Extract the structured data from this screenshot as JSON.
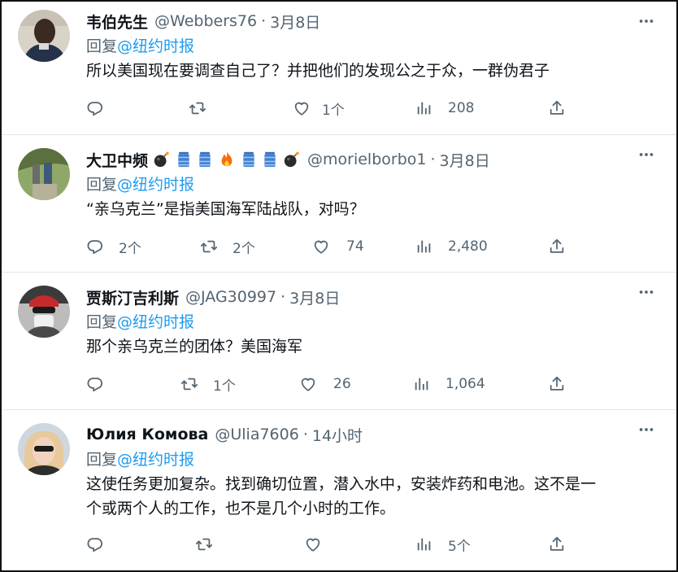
{
  "tweets": [
    {
      "name": "韦伯先生",
      "handle": "@Webbers76",
      "time": "3月8日",
      "reply_prefix": "回复",
      "mention": "@纽约时报",
      "text": "所以美国现在要调查自己了？并把他们的发现公之于众，一群伪君子",
      "replies": "",
      "retweets": "",
      "likes": "1个",
      "views": "208"
    },
    {
      "name": "大卫中频",
      "name_emojis": [
        "bomb-icon",
        "water-bottle-icon",
        "water-bottle-icon",
        "fire-icon",
        "water-bottle-icon",
        "water-bottle-icon",
        "bomb-icon"
      ],
      "handle": "@morielborbo1",
      "time": "3月8日",
      "reply_prefix": "回复",
      "mention": "@纽约时报",
      "text": "“亲乌克兰”是指美国海军陆战队，对吗？",
      "replies": "2个",
      "retweets": "2个",
      "likes": "74",
      "views": "2,480"
    },
    {
      "name": "贾斯汀吉利斯",
      "handle": "@JAG30997",
      "time": "3月8日",
      "reply_prefix": "回复",
      "mention": "@纽约时报",
      "text": "那个亲乌克兰的团体？美国海军",
      "replies": "",
      "retweets": "1个",
      "likes": "26",
      "views": "1,064"
    },
    {
      "name": "Юлия Комова",
      "handle": "@Ulia7606",
      "time": "14小时",
      "reply_prefix": "回复",
      "mention": "@纽约时报",
      "text_line1": "这使任务更加复杂。找到确切位置，潜入水中，安装炸药和电池。这不是一",
      "text_line2": "个或两个人的工作，也不是几个小时的工作。",
      "replies": "",
      "retweets": "",
      "likes": "",
      "views": "5个"
    }
  ],
  "colors": {
    "text": "#0f1419",
    "muted": "#536471",
    "link": "#1d9bf0",
    "divider": "#e3e6e8"
  }
}
